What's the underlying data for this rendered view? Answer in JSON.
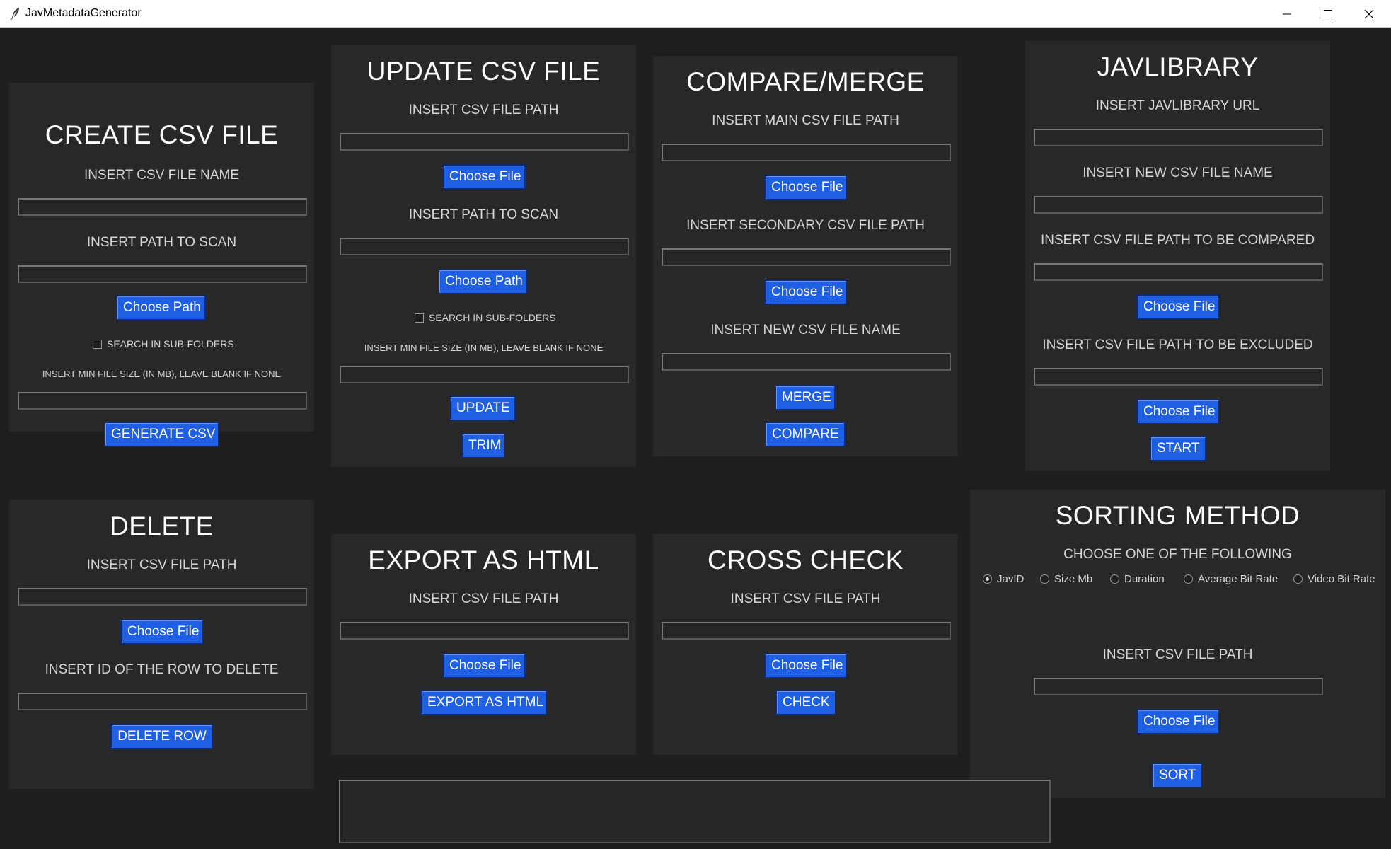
{
  "window": {
    "title": "JavMetadataGenerator"
  },
  "create": {
    "title": "CREATE CSV FILE",
    "name_label": "INSERT CSV FILE NAME",
    "path_label": "INSERT PATH TO SCAN",
    "choose_path": "Choose Path",
    "subfolders": "SEARCH IN SUB-FOLDERS",
    "min_size_label": "INSERT MIN FILE SIZE (IN MB), LEAVE BLANK IF NONE",
    "generate": "GENERATE CSV"
  },
  "update": {
    "title": "UPDATE CSV FILE",
    "csv_label": "INSERT CSV FILE PATH",
    "choose_file": "Choose File",
    "path_label": "INSERT PATH TO SCAN",
    "choose_path": "Choose Path",
    "subfolders": "SEARCH IN SUB-FOLDERS",
    "min_size_label": "INSERT MIN FILE SIZE (IN MB), LEAVE BLANK IF NONE",
    "update": "UPDATE",
    "trim": "TRIM"
  },
  "compare": {
    "title": "COMPARE/MERGE",
    "main_label": "INSERT MAIN CSV FILE PATH",
    "choose_file_1": "Choose File",
    "secondary_label": "INSERT SECONDARY CSV FILE PATH",
    "choose_file_2": "Choose File",
    "new_name_label": "INSERT NEW CSV FILE NAME",
    "merge": "MERGE",
    "compare": "COMPARE"
  },
  "javlibrary": {
    "title": "JAVLIBRARY",
    "url_label": "INSERT JAVLIBRARY URL",
    "new_name_label": "INSERT NEW CSV FILE NAME",
    "compared_label": "INSERT CSV FILE PATH TO BE COMPARED",
    "choose_file_1": "Choose File",
    "excluded_label": "INSERT CSV FILE PATH TO BE EXCLUDED",
    "choose_file_2": "Choose File",
    "start": "START"
  },
  "delete": {
    "title": "DELETE",
    "csv_label": "INSERT CSV FILE PATH",
    "choose_file": "Choose File",
    "row_label": "INSERT ID OF THE ROW TO DELETE",
    "delete_row": "DELETE ROW"
  },
  "export": {
    "title": "EXPORT AS HTML",
    "csv_label": "INSERT CSV FILE PATH",
    "choose_file": "Choose File",
    "export": "EXPORT AS HTML"
  },
  "crosscheck": {
    "title": "CROSS CHECK",
    "csv_label": "INSERT CSV FILE PATH",
    "choose_file": "Choose File",
    "check": "CHECK"
  },
  "sorting": {
    "title": "SORTING METHOD",
    "choose_label": "CHOOSE ONE OF THE FOLLOWING",
    "options": [
      "JavID",
      "Size Mb",
      "Duration",
      "Average Bit Rate",
      "Video Bit Rate"
    ],
    "selected": "JavID",
    "csv_label": "INSERT CSV FILE PATH",
    "choose_file": "Choose File",
    "sort": "SORT"
  },
  "colors": {
    "background": "#1e1e1e",
    "panel": "#282828",
    "button": "#1f5fe3"
  }
}
